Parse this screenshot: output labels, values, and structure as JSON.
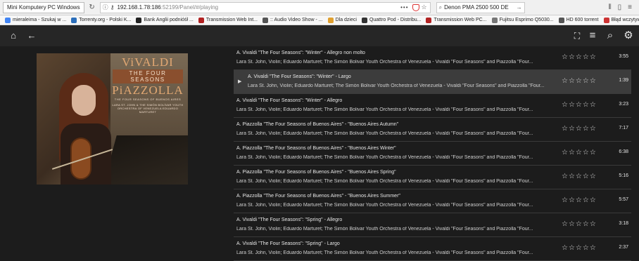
{
  "browser": {
    "tab_title": "Mini Komputery PC Windows",
    "url_host": "192.168.1.78:186",
    "url_path": ":52199/Panel/#/playing",
    "search_value": "Denon PMA 2500 500 DE",
    "overflow_dots": "•••"
  },
  "bookmarks": [
    {
      "label": "mieraleima - Szukaj w ...",
      "color": "#4285f4"
    },
    {
      "label": "Torrenty.org - Polski K...",
      "color": "#2c6fbb"
    },
    {
      "label": "Bank Anglii podnióśł ...",
      "color": "#222222"
    },
    {
      "label": "Transmission Web Int...",
      "color": "#b22222"
    },
    {
      "label": ":: Audio Video Show - ...",
      "color": "#555555"
    },
    {
      "label": "Dla dzieci",
      "color": "#e0a030"
    },
    {
      "label": "Quattro Pod - Distribu...",
      "color": "#333333"
    },
    {
      "label": "Transmission Web PC...",
      "color": "#b22222"
    },
    {
      "label": "Fujitsu Esprimo Q5030...",
      "color": "#777777"
    },
    {
      "label": "HD 600 torrent",
      "color": "#555555"
    },
    {
      "label": "Błąd wczytywania stro...",
      "color": "#cc3333"
    }
  ],
  "appbar": {
    "home_glyph": "⌂",
    "back_glyph": "←",
    "fullscreen_glyph": "⛶",
    "queue_glyph": "≡",
    "search_glyph": "⌕",
    "settings_glyph": "⚙"
  },
  "cover": {
    "line1": "ViVALDI",
    "line2": "THE FOUR SEASONS",
    "line3": "PiAZZOLLA",
    "line4": "THE FOUR SEASONS OF BUENOS AIRES",
    "line5": "LARA ST. JOHN & THE SIMÓN BOLÍVAR YOUTH ORCHESTRA OF VENEZUELA EDUARDO MARTURET"
  },
  "tracks": [
    {
      "title": "A. Vivaldi \"The Four Seasons\": \"Winter\" - Allegro non molto",
      "sub": "Lara St. John, Violin; Eduardo Marturet; The Simón Bolivar Youth Orchestra of Venezuela - Vivaldi \"Four Seasons\" and Piazzolla \"Four...",
      "stars": "☆☆☆☆☆",
      "duration": "3:55",
      "active": false
    },
    {
      "title": "A. Vivaldi \"The Four Seasons\": \"Winter\" - Largo",
      "sub": "Lara St. John, Violin; Eduardo Marturet; The Simón Bolivar Youth Orchestra of Venezuela - Vivaldi \"Four Seasons\" and Piazzolla \"Four...",
      "stars": "☆☆☆☆☆",
      "duration": "1:39",
      "active": true
    },
    {
      "title": "A. Vivaldi \"The Four Seasons\": \"Winter\" - Allegro",
      "sub": "Lara St. John, Violin; Eduardo Marturet; The Simón Bolivar Youth Orchestra of Venezuela - Vivaldi \"Four Seasons\" and Piazzolla \"Four...",
      "stars": "☆☆☆☆☆",
      "duration": "3:23",
      "active": false
    },
    {
      "title": "A. Piazzolla \"The Four Seasons of Buenos Aires\" - \"Buenos Aires Autumn\"",
      "sub": "Lara St. John, Violin; Eduardo Marturet; The Simón Bolivar Youth Orchestra of Venezuela - Vivaldi \"Four Seasons\" and Piazzolla \"Four...",
      "stars": "☆☆☆☆☆",
      "duration": "7:17",
      "active": false
    },
    {
      "title": "A. Piazzolla \"The Four Seasons of Buenos Aires\" - \"Buenos Aires Winter\"",
      "sub": "Lara St. John, Violin; Eduardo Marturet; The Simón Bolivar Youth Orchestra of Venezuela - Vivaldi \"Four Seasons\" and Piazzolla \"Four...",
      "stars": "☆☆☆☆☆",
      "duration": "6:38",
      "active": false
    },
    {
      "title": "A. Piazzolla \"The Four Seasons of Buenos Aires\" - \"Buenos Aires Spring\"",
      "sub": "Lara St. John, Violin; Eduardo Marturet; The Simón Bolivar Youth Orchestra of Venezuela - Vivaldi \"Four Seasons\" and Piazzolla \"Four...",
      "stars": "☆☆☆☆☆",
      "duration": "5:16",
      "active": false
    },
    {
      "title": "A. Piazzolla \"The Four Seasons of Buenos Aires\" - \"Buenos Aires Summer\"",
      "sub": "Lara St. John, Violin; Eduardo Marturet; The Simón Bolivar Youth Orchestra of Venezuela - Vivaldi \"Four Seasons\" and Piazzolla \"Four...",
      "stars": "☆☆☆☆☆",
      "duration": "5:57",
      "active": false
    },
    {
      "title": "A. Vivaldi \"The Four Seasons\": \"Spring\" - Allegro",
      "sub": "Lara St. John, Violin; Eduardo Marturet; The Simón Bolivar Youth Orchestra of Venezuela - Vivaldi \"Four Seasons\" and Piazzolla \"Four...",
      "stars": "☆☆☆☆☆",
      "duration": "3:18",
      "active": false
    },
    {
      "title": "A. Vivaldi \"The Four Seasons\": \"Spring\" - Largo",
      "sub": "Lara St. John, Violin; Eduardo Marturet; The Simón Bolivar Youth Orchestra of Venezuela - Vivaldi \"Four Seasons\" and Piazzolla \"Four...",
      "stars": "☆☆☆☆☆",
      "duration": "2:37",
      "active": false
    }
  ]
}
